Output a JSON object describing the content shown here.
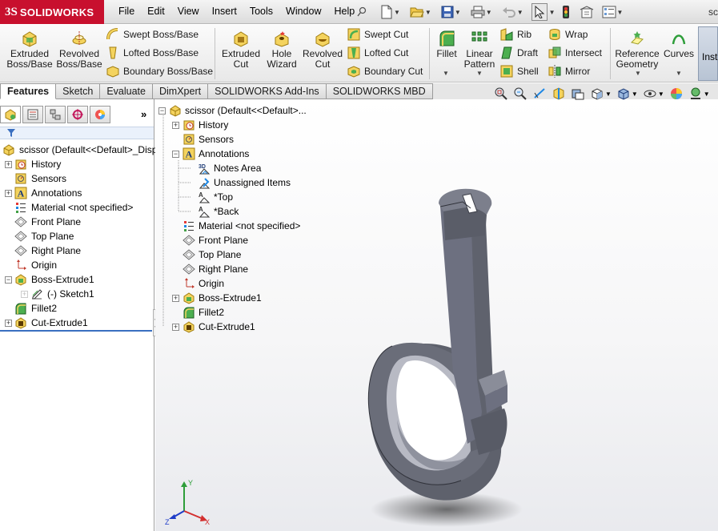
{
  "app": {
    "brand_prefix": "3S",
    "brand": "SOLIDWORKS",
    "title_truncated": "sc"
  },
  "menu": [
    "File",
    "Edit",
    "View",
    "Insert",
    "Tools",
    "Window",
    "Help"
  ],
  "quick_access": [
    "pin-icon",
    "new-document-icon",
    "open-icon",
    "save-icon",
    "print-icon",
    "undo-icon",
    "select-icon",
    "rebuild-icon",
    "file-properties-icon",
    "options-icon"
  ],
  "commands": {
    "extruded_boss": "Extruded\nBoss/Base",
    "revolved_boss": "Revolved\nBoss/Base",
    "swept_boss": "Swept Boss/Base",
    "lofted_boss": "Lofted Boss/Base",
    "boundary_boss": "Boundary Boss/Base",
    "extruded_cut": "Extruded\nCut",
    "hole_wizard": "Hole\nWizard",
    "revolved_cut": "Revolved\nCut",
    "swept_cut": "Swept Cut",
    "lofted_cut": "Lofted Cut",
    "boundary_cut": "Boundary Cut",
    "fillet": "Fillet",
    "linear_pattern": "Linear\nPattern",
    "rib": "Rib",
    "draft": "Draft",
    "shell": "Shell",
    "wrap": "Wrap",
    "intersect": "Intersect",
    "mirror": "Mirror",
    "reference_geometry": "Reference\nGeometry",
    "curves": "Curves",
    "instant3d": "Inst"
  },
  "tabs": [
    "Features",
    "Sketch",
    "Evaluate",
    "DimXpert",
    "SOLIDWORKS Add-Ins",
    "SOLIDWORKS MBD"
  ],
  "active_tab": "Features",
  "panel_tabs": [
    "feature-manager-icon",
    "property-manager-icon",
    "configuration-manager-icon",
    "dimxpert-manager-icon",
    "display-manager-icon"
  ],
  "panel_more": "»",
  "left_tree": {
    "root": "scissor  (Default<<Default>_Disp",
    "items": {
      "history": "History",
      "sensors": "Sensors",
      "annotations": "Annotations",
      "material": "Material <not specified>",
      "front_plane": "Front Plane",
      "top_plane": "Top Plane",
      "right_plane": "Right Plane",
      "origin": "Origin",
      "boss_extrude": "Boss-Extrude1",
      "sketch": "(-) Sketch1",
      "fillet": "Fillet2",
      "cut_extrude": "Cut-Extrude1"
    }
  },
  "flyout_tree": {
    "root": "scissor  (Default<<Default>...",
    "items": {
      "history": "History",
      "sensors": "Sensors",
      "annotations": "Annotations",
      "notes_area": "Notes Area",
      "unassigned": "Unassigned Items",
      "top": "*Top",
      "back": "*Back",
      "material": "Material <not specified>",
      "front_plane": "Front Plane",
      "top_plane": "Top Plane",
      "right_plane": "Right Plane",
      "origin": "Origin",
      "boss_extrude": "Boss-Extrude1",
      "fillet": "Fillet2",
      "cut_extrude": "Cut-Extrude1"
    }
  },
  "triad": {
    "x": "X",
    "y": "Y",
    "z": "Z"
  },
  "colors": {
    "brand_red": "#c8102e",
    "model_face": "#6a6d79",
    "model_inner": "#9ea1ac",
    "accent_blue": "#3a6fc0"
  }
}
